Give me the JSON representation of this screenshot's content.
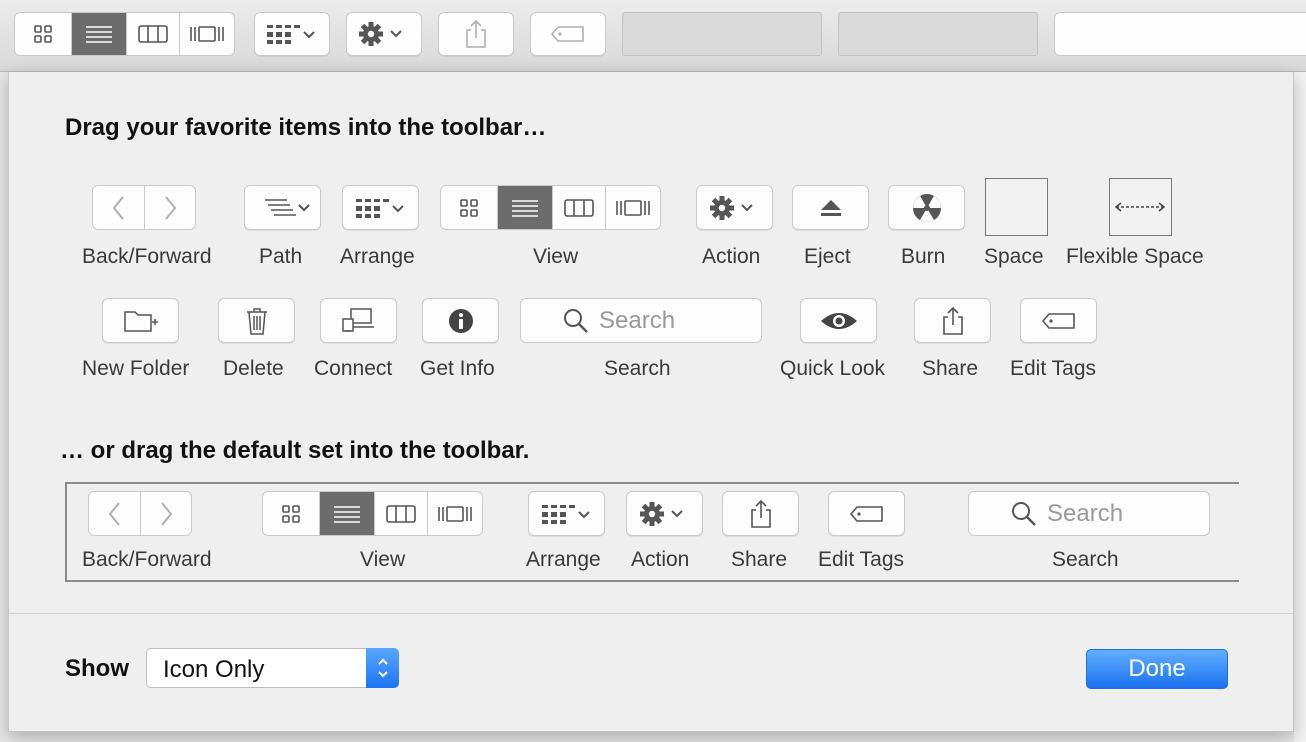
{
  "sheet": {
    "heading_favorites": "Drag your favorite items into the toolbar…",
    "heading_default": "… or drag the default set into the toolbar.",
    "favorites_row1": {
      "back_forward": "Back/Forward",
      "path": "Path",
      "arrange": "Arrange",
      "view": "View",
      "action": "Action",
      "eject": "Eject",
      "burn": "Burn",
      "space": "Space",
      "flexible_space": "Flexible Space"
    },
    "favorites_row2": {
      "new_folder": "New Folder",
      "delete": "Delete",
      "connect": "Connect",
      "get_info": "Get Info",
      "search_placeholder": "Search",
      "search": "Search",
      "quick_look": "Quick Look",
      "share": "Share",
      "edit_tags": "Edit Tags"
    },
    "default_set": {
      "back_forward": "Back/Forward",
      "view": "View",
      "arrange": "Arrange",
      "action": "Action",
      "share": "Share",
      "edit_tags": "Edit Tags",
      "search_placeholder": "Search",
      "search": "Search"
    },
    "show_label": "Show",
    "show_value": "Icon Only",
    "done_label": "Done"
  },
  "colors": {
    "accent": "#1c74f2",
    "selected_segment": "#6c6c6c"
  }
}
